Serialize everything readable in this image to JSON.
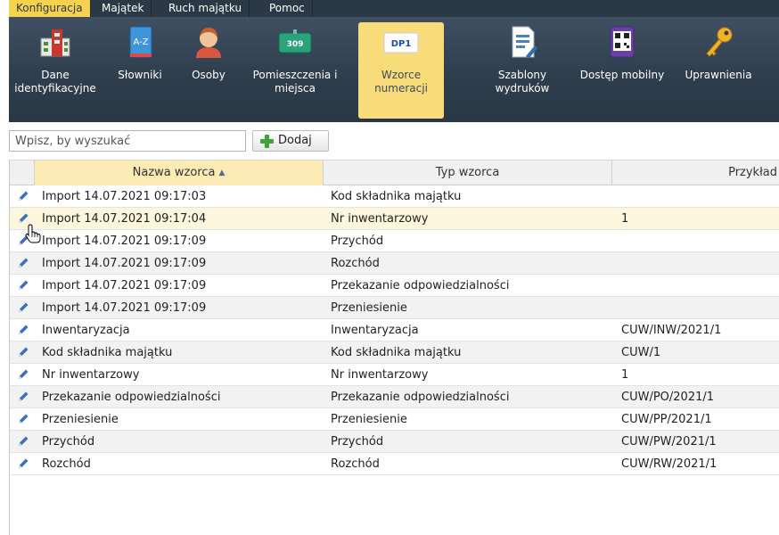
{
  "menu": {
    "tabs": [
      {
        "label": "Konfiguracja",
        "active": true
      },
      {
        "label": "Majątek",
        "active": false
      },
      {
        "label": "Ruch majątku",
        "active": false
      },
      {
        "label": "Pomoc",
        "active": false
      }
    ]
  },
  "toolbar": {
    "items": [
      {
        "label": "Dane identyfikacyjne",
        "icon": "building-icon",
        "active": false
      },
      {
        "label": "Słowniki",
        "icon": "dictionary-icon",
        "active": false
      },
      {
        "label": "Osoby",
        "icon": "person-icon",
        "active": false
      },
      {
        "label": "Pomieszczenia i miejsca",
        "icon": "room-icon",
        "icon_text": "309",
        "active": false
      },
      {
        "label": "Wzorce numeracji",
        "icon": "numbering-pattern-icon",
        "icon_text": "DP1",
        "active": true
      },
      {
        "label": "Szablony wydruków",
        "icon": "print-template-icon",
        "active": false
      },
      {
        "label": "Dostęp mobilny",
        "icon": "mobile-qr-icon",
        "active": false
      },
      {
        "label": "Uprawnienia",
        "icon": "key-icon",
        "active": false
      }
    ]
  },
  "search": {
    "placeholder": "Wpisz, by wyszukać",
    "value": "",
    "add_label": "Dodaj"
  },
  "table": {
    "columns": {
      "name": "Nazwa wzorca",
      "type": "Typ wzorca",
      "example": "Przykład"
    },
    "sort": {
      "column": "name",
      "direction": "ascending"
    },
    "rows": [
      {
        "name": "Import 14.07.2021 09:17:03",
        "type": "Kod składnika majątku",
        "example": ""
      },
      {
        "name": "Import 14.07.2021 09:17:04",
        "type": "Nr inwentarzowy",
        "example": "1"
      },
      {
        "name": "Import 14.07.2021 09:17:09",
        "type": "Przychód",
        "example": ""
      },
      {
        "name": "Import 14.07.2021 09:17:09",
        "type": "Rozchód",
        "example": ""
      },
      {
        "name": "Import 14.07.2021 09:17:09",
        "type": "Przekazanie odpowiedzialności",
        "example": ""
      },
      {
        "name": "Import 14.07.2021 09:17:09",
        "type": "Przeniesienie",
        "example": ""
      },
      {
        "name": "Inwentaryzacja",
        "type": "Inwentaryzacja",
        "example": "CUW/INW/2021/1"
      },
      {
        "name": "Kod składnika majątku",
        "type": "Kod składnika majątku",
        "example": "CUW/1"
      },
      {
        "name": "Nr inwentarzowy",
        "type": "Nr inwentarzowy",
        "example": "1"
      },
      {
        "name": "Przekazanie odpowiedzialności",
        "type": "Przekazanie odpowiedzialności",
        "example": "CUW/PO/2021/1"
      },
      {
        "name": "Przeniesienie",
        "type": "Przeniesienie",
        "example": "CUW/PP/2021/1"
      },
      {
        "name": "Przychód",
        "type": "Przychód",
        "example": "CUW/PW/2021/1"
      },
      {
        "name": "Rozchód",
        "type": "Rozchód",
        "example": "CUW/RW/2021/1"
      }
    ]
  },
  "colors": {
    "menu_active": "#f7d24c",
    "ribbon": "#2e3d4c",
    "tool_active": "#f8dc7a",
    "row_hover": "#fdf6dc",
    "pencil": "#3a6fc2"
  }
}
